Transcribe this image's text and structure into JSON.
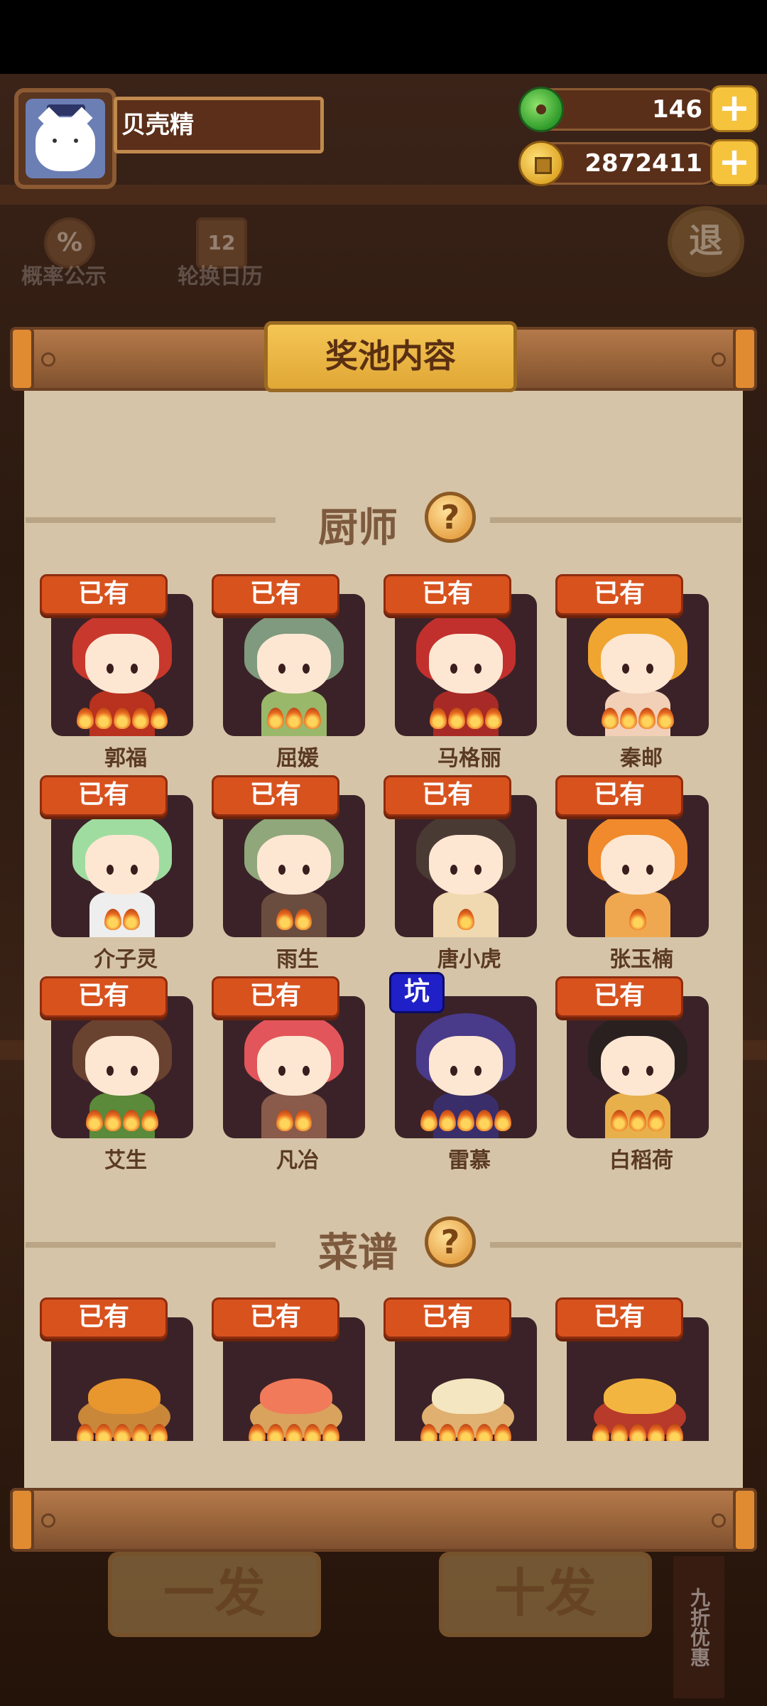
{
  "player": {
    "name": "贝壳精"
  },
  "currency": {
    "jade": "146",
    "coins": "2872411",
    "add_symbol": "+"
  },
  "background_menu": {
    "probability_label": "概率公示",
    "probability_icon": "%",
    "calendar_label": "轮换日历",
    "calendar_icon": "12",
    "exit_label": "退",
    "single_pull": "一发",
    "ten_pull": "十发",
    "discount": "九折优惠"
  },
  "panel": {
    "title": "奖池内容",
    "chefs_section": {
      "title": "厨师",
      "help": "?"
    },
    "recipes_section": {
      "title": "菜谱",
      "help": "?"
    }
  },
  "chefs": [
    {
      "name": "郭福",
      "badge": "已有",
      "stars": 5,
      "hair": "#c8382c",
      "body": "#b8321f"
    },
    {
      "name": "屈媛",
      "badge": "已有",
      "stars": 3,
      "hair": "#7f9a7e",
      "body": "#9ab86a"
    },
    {
      "name": "马格丽",
      "badge": "已有",
      "stars": 4,
      "hair": "#c2302e",
      "body": "#a82a26"
    },
    {
      "name": "秦邮",
      "badge": "已有",
      "stars": 4,
      "hair": "#f0a530",
      "body": "#f2d0b8"
    },
    {
      "name": "介子灵",
      "badge": "已有",
      "stars": 2,
      "hair": "#9fdca0",
      "body": "#eeeeee"
    },
    {
      "name": "雨生",
      "badge": "已有",
      "stars": 2,
      "hair": "#8fa77a",
      "body": "#6a4d3e"
    },
    {
      "name": "唐小虎",
      "badge": "已有",
      "stars": 1,
      "hair": "#4a3a34",
      "body": "#f0d9b0"
    },
    {
      "name": "张玉楠",
      "badge": "已有",
      "stars": 1,
      "hair": "#f08a2c",
      "body": "#f0a850"
    },
    {
      "name": "艾生",
      "badge": "已有",
      "stars": 4,
      "hair": "#6a4230",
      "body": "#5a8a3a"
    },
    {
      "name": "凡冶",
      "badge": "已有",
      "stars": 2,
      "hair": "#e2555a",
      "body": "#8a5a4a"
    },
    {
      "name": "雷慕",
      "badge": "坑",
      "stars": 5,
      "hair": "#4a3a8a",
      "body": "#3a2e6a"
    },
    {
      "name": "白稻荷",
      "badge": "已有",
      "stars": 3,
      "hair": "#2a2020",
      "body": "#e8b04a"
    }
  ],
  "recipes": [
    {
      "badge": "已有",
      "stars": 5,
      "plate": "#c9873a",
      "food": "#e8962e"
    },
    {
      "badge": "已有",
      "stars": 5,
      "plate": "#d9a35e",
      "food": "#f07a5a"
    },
    {
      "badge": "已有",
      "stars": 5,
      "plate": "#e0b070",
      "food": "#f4e6c0"
    },
    {
      "badge": "已有",
      "stars": 5,
      "plate": "#b83a2a",
      "food": "#f2b640"
    }
  ]
}
